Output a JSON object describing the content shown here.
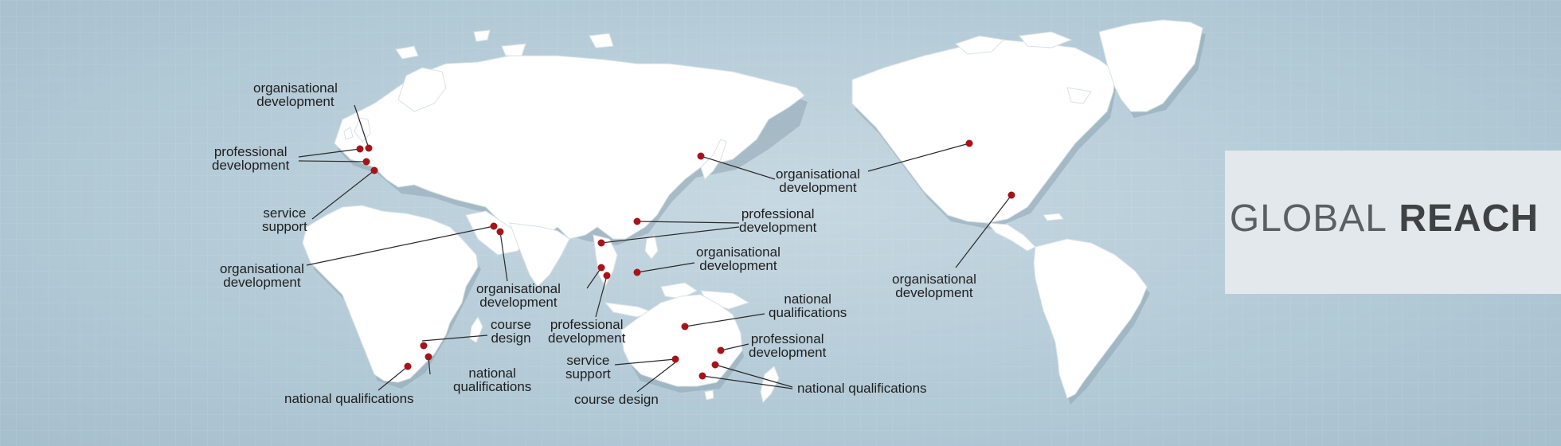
{
  "title": {
    "light": "GLOBAL",
    "bold": "REACH"
  },
  "colors": {
    "background": "#b9cdd8",
    "land": "#ffffff",
    "marker": "#a5141a",
    "panel": "#e2e8eb"
  },
  "markers": [
    {
      "id": "uk-org",
      "label": [
        "organisational",
        "development"
      ]
    },
    {
      "id": "uk-prof",
      "label": [
        "professional",
        "development"
      ]
    },
    {
      "id": "uk-service",
      "label": [
        "service",
        "support"
      ]
    },
    {
      "id": "gulf-org",
      "label": [
        "organisational",
        "development"
      ]
    },
    {
      "id": "india-org",
      "label": [
        "organisational",
        "development"
      ]
    },
    {
      "id": "sa-course",
      "label": [
        "course",
        "design"
      ]
    },
    {
      "id": "sa-natq",
      "label": [
        "national",
        "qualifications"
      ]
    },
    {
      "id": "sa-natq2",
      "label": [
        "national qualifications"
      ]
    },
    {
      "id": "korea-org",
      "label": [
        "organisational",
        "development"
      ]
    },
    {
      "id": "china-prof",
      "label": [
        "professional",
        "development"
      ]
    },
    {
      "id": "asia-org",
      "label": [
        "organisational",
        "development"
      ]
    },
    {
      "id": "sea-prof",
      "label": [
        "professional",
        "development"
      ]
    },
    {
      "id": "au-natq",
      "label": [
        "national",
        "qualifications"
      ]
    },
    {
      "id": "au-prof",
      "label": [
        "professional",
        "development"
      ]
    },
    {
      "id": "au-service",
      "label": [
        "service",
        "support"
      ]
    },
    {
      "id": "au-course",
      "label": [
        "course design"
      ]
    },
    {
      "id": "au-natq2",
      "label": [
        "national qualifications"
      ]
    },
    {
      "id": "us-org",
      "label": [
        "organisational",
        "development"
      ]
    },
    {
      "id": "us-org2",
      "label": [
        "organisational",
        "development"
      ]
    }
  ]
}
